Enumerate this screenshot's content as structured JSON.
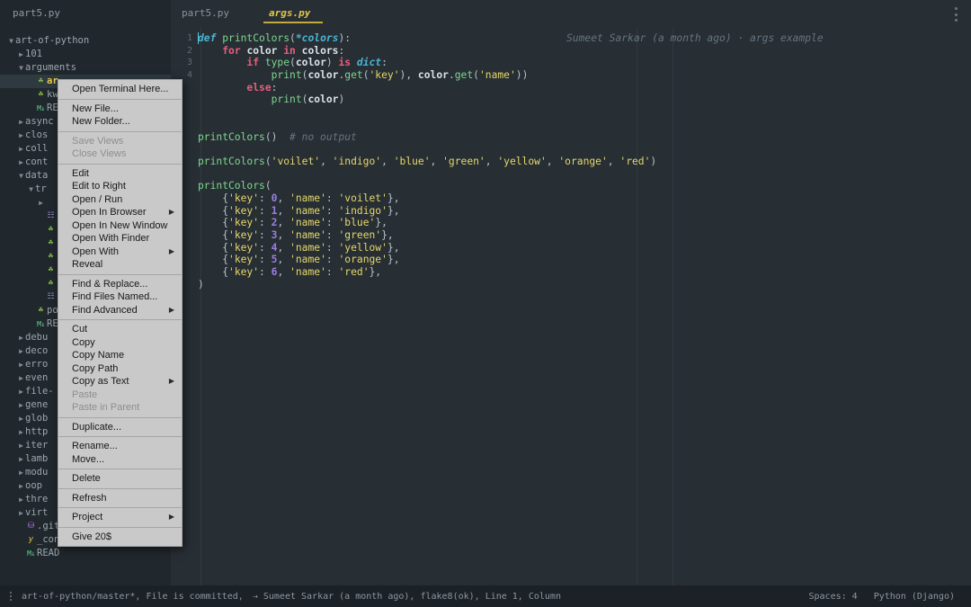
{
  "sidebar": {
    "header": "part5.py",
    "tree": [
      {
        "depth": 0,
        "twisty": "down",
        "icon": "",
        "label": "art-of-python"
      },
      {
        "depth": 1,
        "twisty": "right",
        "icon": "",
        "label": "101"
      },
      {
        "depth": 1,
        "twisty": "down",
        "icon": "",
        "label": "arguments"
      },
      {
        "depth": 2,
        "twisty": "none",
        "icon": "py",
        "label": "ar",
        "selected": true
      },
      {
        "depth": 2,
        "twisty": "none",
        "icon": "py",
        "label": "kw"
      },
      {
        "depth": 2,
        "twisty": "none",
        "icon": "md",
        "label": "RE"
      },
      {
        "depth": 1,
        "twisty": "right",
        "icon": "",
        "label": "async"
      },
      {
        "depth": 1,
        "twisty": "right",
        "icon": "",
        "label": "clos"
      },
      {
        "depth": 1,
        "twisty": "right",
        "icon": "",
        "label": "coll"
      },
      {
        "depth": 1,
        "twisty": "right",
        "icon": "",
        "label": "cont"
      },
      {
        "depth": 1,
        "twisty": "down",
        "icon": "",
        "label": "data"
      },
      {
        "depth": 2,
        "twisty": "down",
        "icon": "",
        "label": "tr"
      },
      {
        "depth": 3,
        "twisty": "right",
        "icon": "",
        "label": ""
      },
      {
        "depth": 3,
        "twisty": "none",
        "icon": "db",
        "label": ""
      },
      {
        "depth": 3,
        "twisty": "none",
        "icon": "py",
        "label": ""
      },
      {
        "depth": 3,
        "twisty": "none",
        "icon": "py",
        "label": ""
      },
      {
        "depth": 3,
        "twisty": "none",
        "icon": "py",
        "label": ""
      },
      {
        "depth": 3,
        "twisty": "none",
        "icon": "py",
        "label": ""
      },
      {
        "depth": 3,
        "twisty": "none",
        "icon": "py",
        "label": ""
      },
      {
        "depth": 3,
        "twisty": "none",
        "icon": "db",
        "label": ""
      },
      {
        "depth": 2,
        "twisty": "none",
        "icon": "py",
        "label": "po"
      },
      {
        "depth": 2,
        "twisty": "none",
        "icon": "md",
        "label": "RE"
      },
      {
        "depth": 1,
        "twisty": "right",
        "icon": "",
        "label": "debu"
      },
      {
        "depth": 1,
        "twisty": "right",
        "icon": "",
        "label": "deco"
      },
      {
        "depth": 1,
        "twisty": "right",
        "icon": "",
        "label": "erro"
      },
      {
        "depth": 1,
        "twisty": "right",
        "icon": "",
        "label": "even"
      },
      {
        "depth": 1,
        "twisty": "right",
        "icon": "",
        "label": "file-"
      },
      {
        "depth": 1,
        "twisty": "right",
        "icon": "",
        "label": "gene"
      },
      {
        "depth": 1,
        "twisty": "right",
        "icon": "",
        "label": "glob"
      },
      {
        "depth": 1,
        "twisty": "right",
        "icon": "",
        "label": "http"
      },
      {
        "depth": 1,
        "twisty": "right",
        "icon": "",
        "label": "iter"
      },
      {
        "depth": 1,
        "twisty": "right",
        "icon": "",
        "label": "lamb"
      },
      {
        "depth": 1,
        "twisty": "right",
        "icon": "",
        "label": "modu"
      },
      {
        "depth": 1,
        "twisty": "right",
        "icon": "",
        "label": "oop"
      },
      {
        "depth": 1,
        "twisty": "right",
        "icon": "",
        "label": "thre"
      },
      {
        "depth": 1,
        "twisty": "right",
        "icon": "",
        "label": "virt"
      },
      {
        "depth": 1,
        "twisty": "none",
        "icon": "git",
        "label": ".git"
      },
      {
        "depth": 1,
        "twisty": "none",
        "icon": "y",
        "label": "_con"
      },
      {
        "depth": 1,
        "twisty": "none",
        "icon": "md",
        "label": "READ"
      }
    ]
  },
  "tabs": [
    {
      "label": "part5.py",
      "active": false
    },
    {
      "label": "args.py",
      "active": true
    }
  ],
  "overflow_menu_icon": "vertical-dots-icon",
  "editor": {
    "line_numbers": [
      "1",
      "2",
      "3",
      "4"
    ],
    "blame": "Sumeet Sarkar (a month ago) · args example",
    "lines": [
      {
        "tokens": [
          {
            "t": "def ",
            "c": "kb"
          },
          {
            "t": "printColors",
            "c": "fn"
          },
          {
            "t": "(",
            "c": "pn"
          },
          {
            "t": "*colors",
            "c": "kb"
          },
          {
            "t": "):",
            "c": "pn"
          }
        ]
      },
      {
        "tokens": [
          {
            "t": "    ",
            "c": "pn"
          },
          {
            "t": "for ",
            "c": "k"
          },
          {
            "t": "color",
            "c": "va"
          },
          {
            "t": " in ",
            "c": "k"
          },
          {
            "t": "colors",
            "c": "va"
          },
          {
            "t": ":",
            "c": "pn"
          }
        ]
      },
      {
        "tokens": [
          {
            "t": "        ",
            "c": "pn"
          },
          {
            "t": "if ",
            "c": "k"
          },
          {
            "t": "type",
            "c": "fn"
          },
          {
            "t": "(",
            "c": "pn"
          },
          {
            "t": "color",
            "c": "va"
          },
          {
            "t": ") ",
            "c": "pn"
          },
          {
            "t": "is ",
            "c": "k"
          },
          {
            "t": "dict",
            "c": "kb"
          },
          {
            "t": ":",
            "c": "pn"
          }
        ]
      },
      {
        "tokens": [
          {
            "t": "            ",
            "c": "pn"
          },
          {
            "t": "print",
            "c": "fn"
          },
          {
            "t": "(",
            "c": "pn"
          },
          {
            "t": "color",
            "c": "va"
          },
          {
            "t": ".",
            "c": "pn"
          },
          {
            "t": "get",
            "c": "fn"
          },
          {
            "t": "(",
            "c": "pn"
          },
          {
            "t": "'key'",
            "c": "st"
          },
          {
            "t": "), ",
            "c": "pn"
          },
          {
            "t": "color",
            "c": "va"
          },
          {
            "t": ".",
            "c": "pn"
          },
          {
            "t": "get",
            "c": "fn"
          },
          {
            "t": "(",
            "c": "pn"
          },
          {
            "t": "'name'",
            "c": "st"
          },
          {
            "t": "))",
            "c": "pn"
          }
        ]
      },
      {
        "tokens": [
          {
            "t": "        ",
            "c": "pn"
          },
          {
            "t": "else",
            "c": "k"
          },
          {
            "t": ":",
            "c": "pn"
          }
        ]
      },
      {
        "tokens": [
          {
            "t": "            ",
            "c": "pn"
          },
          {
            "t": "print",
            "c": "fn"
          },
          {
            "t": "(",
            "c": "pn"
          },
          {
            "t": "color",
            "c": "va"
          },
          {
            "t": ")",
            "c": "pn"
          }
        ]
      },
      {
        "tokens": []
      },
      {
        "tokens": []
      },
      {
        "tokens": [
          {
            "t": "printColors",
            "c": "fn"
          },
          {
            "t": "()  ",
            "c": "pn"
          },
          {
            "t": "# no output",
            "c": "cm"
          }
        ]
      },
      {
        "tokens": []
      },
      {
        "tokens": [
          {
            "t": "printColors",
            "c": "fn"
          },
          {
            "t": "(",
            "c": "pn"
          },
          {
            "t": "'voilet'",
            "c": "st"
          },
          {
            "t": ", ",
            "c": "pn"
          },
          {
            "t": "'indigo'",
            "c": "st"
          },
          {
            "t": ", ",
            "c": "pn"
          },
          {
            "t": "'blue'",
            "c": "st"
          },
          {
            "t": ", ",
            "c": "pn"
          },
          {
            "t": "'green'",
            "c": "st"
          },
          {
            "t": ", ",
            "c": "pn"
          },
          {
            "t": "'yellow'",
            "c": "st"
          },
          {
            "t": ", ",
            "c": "pn"
          },
          {
            "t": "'orange'",
            "c": "st"
          },
          {
            "t": ", ",
            "c": "pn"
          },
          {
            "t": "'red'",
            "c": "st"
          },
          {
            "t": ")",
            "c": "pn"
          }
        ]
      },
      {
        "tokens": []
      },
      {
        "tokens": [
          {
            "t": "printColors",
            "c": "fn"
          },
          {
            "t": "(",
            "c": "pn"
          }
        ]
      },
      {
        "tokens": [
          {
            "t": "    {",
            "c": "pn"
          },
          {
            "t": "'key'",
            "c": "st"
          },
          {
            "t": ": ",
            "c": "pn"
          },
          {
            "t": "0",
            "c": "nu"
          },
          {
            "t": ", ",
            "c": "pn"
          },
          {
            "t": "'name'",
            "c": "st"
          },
          {
            "t": ": ",
            "c": "pn"
          },
          {
            "t": "'voilet'",
            "c": "st"
          },
          {
            "t": "},",
            "c": "pn"
          }
        ]
      },
      {
        "tokens": [
          {
            "t": "    {",
            "c": "pn"
          },
          {
            "t": "'key'",
            "c": "st"
          },
          {
            "t": ": ",
            "c": "pn"
          },
          {
            "t": "1",
            "c": "nu"
          },
          {
            "t": ", ",
            "c": "pn"
          },
          {
            "t": "'name'",
            "c": "st"
          },
          {
            "t": ": ",
            "c": "pn"
          },
          {
            "t": "'indigo'",
            "c": "st"
          },
          {
            "t": "},",
            "c": "pn"
          }
        ]
      },
      {
        "tokens": [
          {
            "t": "    {",
            "c": "pn"
          },
          {
            "t": "'key'",
            "c": "st"
          },
          {
            "t": ": ",
            "c": "pn"
          },
          {
            "t": "2",
            "c": "nu"
          },
          {
            "t": ", ",
            "c": "pn"
          },
          {
            "t": "'name'",
            "c": "st"
          },
          {
            "t": ": ",
            "c": "pn"
          },
          {
            "t": "'blue'",
            "c": "st"
          },
          {
            "t": "},",
            "c": "pn"
          }
        ]
      },
      {
        "tokens": [
          {
            "t": "    {",
            "c": "pn"
          },
          {
            "t": "'key'",
            "c": "st"
          },
          {
            "t": ": ",
            "c": "pn"
          },
          {
            "t": "3",
            "c": "nu"
          },
          {
            "t": ", ",
            "c": "pn"
          },
          {
            "t": "'name'",
            "c": "st"
          },
          {
            "t": ": ",
            "c": "pn"
          },
          {
            "t": "'green'",
            "c": "st"
          },
          {
            "t": "},",
            "c": "pn"
          }
        ]
      },
      {
        "tokens": [
          {
            "t": "    {",
            "c": "pn"
          },
          {
            "t": "'key'",
            "c": "st"
          },
          {
            "t": ": ",
            "c": "pn"
          },
          {
            "t": "4",
            "c": "nu"
          },
          {
            "t": ", ",
            "c": "pn"
          },
          {
            "t": "'name'",
            "c": "st"
          },
          {
            "t": ": ",
            "c": "pn"
          },
          {
            "t": "'yellow'",
            "c": "st"
          },
          {
            "t": "},",
            "c": "pn"
          }
        ]
      },
      {
        "tokens": [
          {
            "t": "    {",
            "c": "pn"
          },
          {
            "t": "'key'",
            "c": "st"
          },
          {
            "t": ": ",
            "c": "pn"
          },
          {
            "t": "5",
            "c": "nu"
          },
          {
            "t": ", ",
            "c": "pn"
          },
          {
            "t": "'name'",
            "c": "st"
          },
          {
            "t": ": ",
            "c": "pn"
          },
          {
            "t": "'orange'",
            "c": "st"
          },
          {
            "t": "},",
            "c": "pn"
          }
        ]
      },
      {
        "tokens": [
          {
            "t": "    {",
            "c": "pn"
          },
          {
            "t": "'key'",
            "c": "st"
          },
          {
            "t": ": ",
            "c": "pn"
          },
          {
            "t": "6",
            "c": "nu"
          },
          {
            "t": ", ",
            "c": "pn"
          },
          {
            "t": "'name'",
            "c": "st"
          },
          {
            "t": ": ",
            "c": "pn"
          },
          {
            "t": "'red'",
            "c": "st"
          },
          {
            "t": "},",
            "c": "pn"
          }
        ]
      },
      {
        "tokens": [
          {
            "t": ")",
            "c": "pn"
          }
        ]
      }
    ]
  },
  "context_menu": [
    {
      "label": "Open Terminal Here...",
      "disabled": false,
      "submenu": false
    },
    {
      "sep": true
    },
    {
      "label": "New File...",
      "disabled": false,
      "submenu": false
    },
    {
      "label": "New Folder...",
      "disabled": false,
      "submenu": false
    },
    {
      "sep": true
    },
    {
      "label": "Save Views",
      "disabled": true,
      "submenu": false
    },
    {
      "label": "Close Views",
      "disabled": true,
      "submenu": false
    },
    {
      "sep": true
    },
    {
      "label": "Edit",
      "disabled": false,
      "submenu": false
    },
    {
      "label": "Edit to Right",
      "disabled": false,
      "submenu": false
    },
    {
      "label": "Open / Run",
      "disabled": false,
      "submenu": false
    },
    {
      "label": "Open In Browser",
      "disabled": false,
      "submenu": true
    },
    {
      "label": "Open In New Window",
      "disabled": false,
      "submenu": false
    },
    {
      "label": "Open With Finder",
      "disabled": false,
      "submenu": false
    },
    {
      "label": "Open With",
      "disabled": false,
      "submenu": true
    },
    {
      "label": "Reveal",
      "disabled": false,
      "submenu": false
    },
    {
      "sep": true
    },
    {
      "label": "Find & Replace...",
      "disabled": false,
      "submenu": false
    },
    {
      "label": "Find Files Named...",
      "disabled": false,
      "submenu": false
    },
    {
      "label": "Find Advanced",
      "disabled": false,
      "submenu": true
    },
    {
      "sep": true
    },
    {
      "label": "Cut",
      "disabled": false,
      "submenu": false
    },
    {
      "label": "Copy",
      "disabled": false,
      "submenu": false
    },
    {
      "label": "Copy Name",
      "disabled": false,
      "submenu": false
    },
    {
      "label": "Copy Path",
      "disabled": false,
      "submenu": false
    },
    {
      "label": "Copy as Text",
      "disabled": false,
      "submenu": true
    },
    {
      "label": "Paste",
      "disabled": true,
      "submenu": false
    },
    {
      "label": "Paste in Parent",
      "disabled": true,
      "submenu": false
    },
    {
      "sep": true
    },
    {
      "label": "Duplicate...",
      "disabled": false,
      "submenu": false
    },
    {
      "sep": true
    },
    {
      "label": "Rename...",
      "disabled": false,
      "submenu": false
    },
    {
      "label": "Move...",
      "disabled": false,
      "submenu": false
    },
    {
      "sep": true
    },
    {
      "label": "Delete",
      "disabled": false,
      "submenu": false
    },
    {
      "sep": true
    },
    {
      "label": "Refresh",
      "disabled": false,
      "submenu": false
    },
    {
      "sep": true
    },
    {
      "label": "Project",
      "disabled": false,
      "submenu": true
    },
    {
      "sep": true
    },
    {
      "label": "Give 20$",
      "disabled": false,
      "submenu": false
    }
  ],
  "status_bar": {
    "menu_icon": "vertical-dots-icon",
    "branch": "art-of-python/master*,",
    "commit_state": "File is committed,",
    "author": "⇢ Sumeet Sarkar (a month ago),",
    "lint": "flake8(ok),",
    "cursor": "Line 1, Column",
    "spaces": "Spaces: 4",
    "syntax": "Python (Django)"
  },
  "colors": {
    "editor_bg": "#272e34",
    "sidebar_bg": "#21282d",
    "status_bg": "#1b2126",
    "accent": "#e3c74b",
    "menu_bg": "#c9c9c9"
  }
}
